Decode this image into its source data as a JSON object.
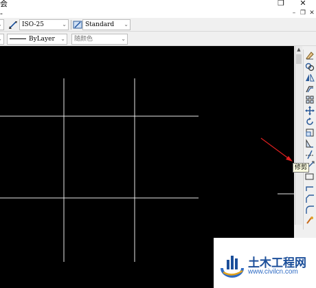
{
  "window": {
    "title_fragment": "会",
    "restore_symbol": "❐",
    "close_symbol": "✕",
    "drawing_title_fragment": "-",
    "minimize_symbol": "–",
    "sub_restore_symbol": "❐",
    "sub_close_symbol": "✕"
  },
  "styles_toolbar": {
    "dim_style": "ISO-25",
    "table_style": "Standard"
  },
  "properties_toolbar": {
    "linetype": "ByLayer",
    "color": "随颜色"
  },
  "modify_toolbar": {
    "icons": [
      "erase-icon",
      "copy-icon",
      "mirror-icon",
      "offset-icon",
      "array-icon",
      "move-icon",
      "rotate-icon",
      "scale-icon",
      "stretch-icon",
      "trim-icon",
      "extend-icon",
      "break-icon",
      "join-icon",
      "chamfer-icon",
      "fillet-icon",
      "explode-icon"
    ],
    "tooltip": "修剪"
  },
  "watermark": {
    "title": "土木工程网",
    "url": "www.civilcn.com",
    "brand_color": "#1c4f9a"
  },
  "colors": {
    "canvas_bg": "#000000",
    "drawing_lines": "#ffffff",
    "annotation_arrow": "#e02020"
  }
}
